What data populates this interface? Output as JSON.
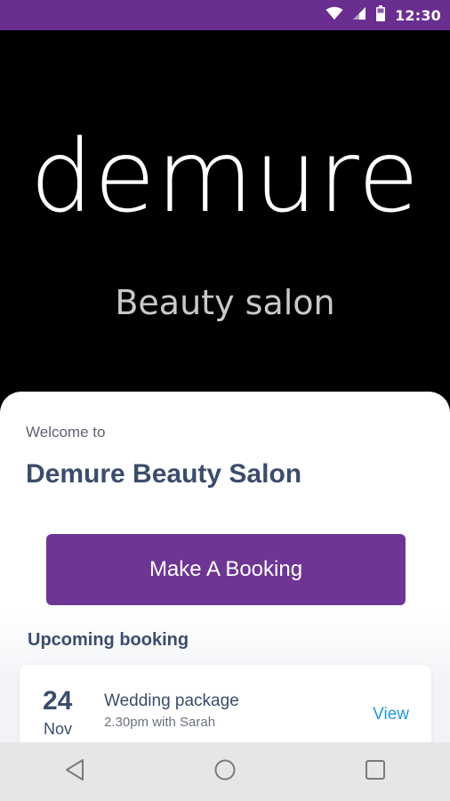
{
  "status_bar": {
    "time": "12:30",
    "icons": [
      "wifi-icon",
      "cellular-signal-icon",
      "battery-icon"
    ],
    "background_color": "#6a2e91"
  },
  "hero": {
    "logo_word": "demure",
    "logo_subtitle": "Beauty salon",
    "background_color": "#000000"
  },
  "welcome": {
    "label": "Welcome to",
    "salon_name": "Demure Beauty Salon"
  },
  "actions": {
    "make_booking_label": "Make A Booking",
    "button_color": "#6f3594"
  },
  "upcoming": {
    "title": "Upcoming booking",
    "booking": {
      "day": "24",
      "month": "Nov",
      "service": "Wedding package",
      "detail": "2.30pm with Sarah",
      "view_label": "View"
    }
  },
  "nav_bar": {
    "buttons": [
      "back-icon",
      "home-icon",
      "recents-icon"
    ]
  },
  "colors": {
    "heading": "#3b4d6b",
    "link": "#1f9ad6"
  }
}
